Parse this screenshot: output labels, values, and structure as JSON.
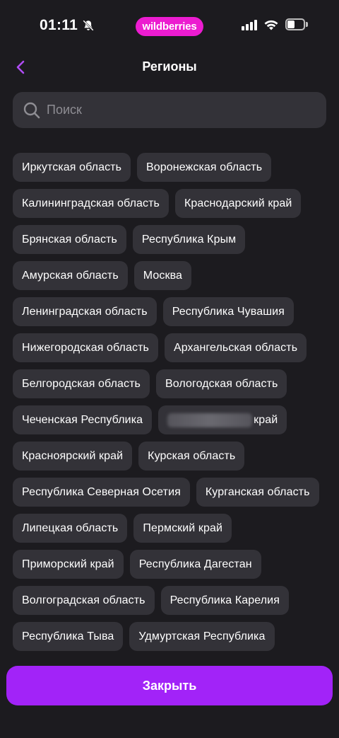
{
  "status_bar": {
    "time": "01:11",
    "brand": "wildberries"
  },
  "header": {
    "title": "Регионы"
  },
  "search": {
    "placeholder": "Поиск",
    "value": ""
  },
  "regions": [
    "Иркутская область",
    "Воронежская область",
    "Калининградская область",
    "Краснодарский край",
    "Брянская область",
    "Республика Крым",
    "Амурская область",
    "Москва",
    "Ленинградская область",
    "Республика Чувашия",
    "Нижегородская область",
    "Архангельская область",
    "Белгородская область",
    "Вологодская область",
    "Чеченская Республика",
    "край",
    "Красноярский край",
    "Курская область",
    "Республика Северная Осетия",
    "Курганская область",
    "Липецкая область",
    "Пермский край",
    "Приморский край",
    "Республика Дагестан",
    "Волгоградская область",
    "Республика Карелия",
    "Республика Тыва",
    "Удмуртская Республика"
  ],
  "footer": {
    "close_label": "Закрыть"
  },
  "colors": {
    "background": "#1c1b1f",
    "chip": "#333238",
    "accent": "#a223f8",
    "brand": "#ec1cd0"
  },
  "icons": {
    "back": "chevron-left-icon",
    "search": "search-icon",
    "bell": "bell-slash-icon"
  }
}
